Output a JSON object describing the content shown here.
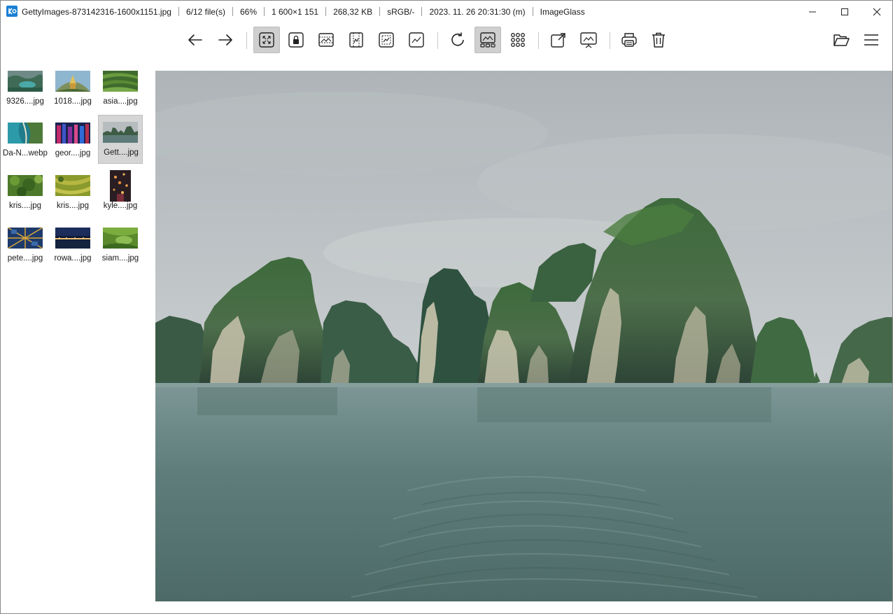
{
  "titlebar": {
    "filename": "GettyImages-873142316-1600x1151.jpg",
    "file_index": "6/12 file(s)",
    "zoom": "66%",
    "dimensions": "1 600×1 151",
    "file_size": "268,32 KB",
    "color_profile": "sRGB/-",
    "datetime": "2023. 11. 26 20:31:30 (m)",
    "app_name": "ImageGlass"
  },
  "toolbar": {
    "icons": [
      "arrow-left-icon",
      "arrow-right-icon",
      "zoom-auto-icon",
      "lock-zoom-icon",
      "scale-to-width-icon",
      "scale-to-height-icon",
      "scale-to-fit-icon",
      "scale-to-fill-icon",
      "refresh-icon",
      "gallery-icon",
      "checkerboard-icon",
      "fullscreen-icon",
      "slideshow-icon",
      "print-icon",
      "delete-icon",
      "open-file-icon",
      "menu-icon"
    ],
    "active": [
      "zoom-auto",
      "gallery"
    ]
  },
  "thumbnails": {
    "selected_index": 5,
    "items": [
      {
        "label": "9326....jpg"
      },
      {
        "label": "1018....jpg"
      },
      {
        "label": "asia....jpg"
      },
      {
        "label": "Da-N...webp"
      },
      {
        "label": "geor....jpg"
      },
      {
        "label": "Gett....jpg"
      },
      {
        "label": "kris....jpg"
      },
      {
        "label": "kris....jpg"
      },
      {
        "label": "kyle....jpg"
      },
      {
        "label": "pete....jpg"
      },
      {
        "label": "rowa....jpg"
      },
      {
        "label": "siam....jpg"
      }
    ]
  }
}
